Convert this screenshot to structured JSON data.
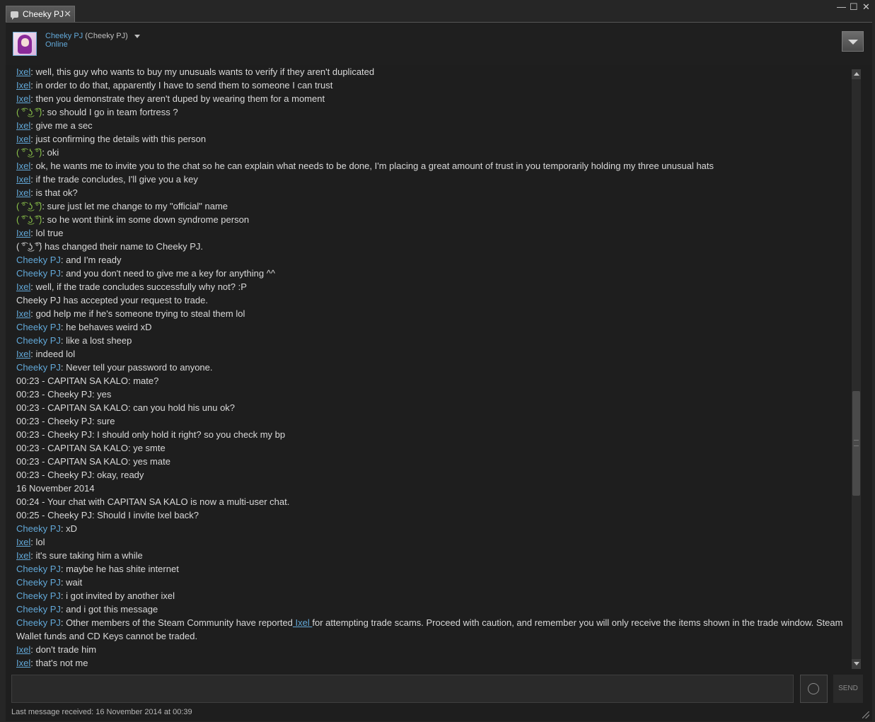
{
  "tab": {
    "title": "Cheeky PJ",
    "close": "✕"
  },
  "window": {
    "minimize": "—",
    "maximize": "☐",
    "close": "✕"
  },
  "friend": {
    "name": "Cheeky PJ",
    "alias": "(Cheeky PJ)",
    "status": "Online"
  },
  "messages": [
    {
      "sender": "Ixel",
      "style": "ixel",
      "sep": ": ",
      "text": "well, this guy who wants to buy my unusuals wants to verify if they aren't duplicated"
    },
    {
      "sender": "Ixel",
      "style": "ixel",
      "sep": ": ",
      "text": "in order to do that, apparently I have to send them to someone I can trust"
    },
    {
      "sender": "Ixel",
      "style": "ixel",
      "sep": ": ",
      "text": "then you demonstrate they aren't duped by wearing them for a moment"
    },
    {
      "sender": "( ͡° ͜ʖ ͡°)",
      "style": "lenny",
      "sep": ": ",
      "text": "so should I go in team fortress ?"
    },
    {
      "sender": "Ixel",
      "style": "ixel",
      "sep": ": ",
      "text": "give me a sec"
    },
    {
      "sender": "Ixel",
      "style": "ixel",
      "sep": ": ",
      "text": "just confirming the details with this person"
    },
    {
      "sender": "( ͡° ͜ʖ ͡°)",
      "style": "lenny",
      "sep": ": ",
      "text": "oki"
    },
    {
      "sender": "Ixel",
      "style": "ixel",
      "sep": ": ",
      "text": "ok, he wants me to invite you to the chat so he can explain what needs to be done, I'm placing a great amount of trust in you temporarily holding my three unusual hats"
    },
    {
      "sender": "Ixel",
      "style": "ixel",
      "sep": ": ",
      "text": "if the trade concludes, I'll give you a key"
    },
    {
      "sender": "Ixel",
      "style": "ixel",
      "sep": ": ",
      "text": "is that ok?"
    },
    {
      "sender": "( ͡° ͜ʖ ͡°)",
      "style": "lenny",
      "sep": ": ",
      "text": "sure just let me change to my \"official\" name"
    },
    {
      "sender": "( ͡° ͜ʖ ͡°)",
      "style": "lenny",
      "sep": ": ",
      "text": "so he wont think im some down syndrome person"
    },
    {
      "sender": "Ixel",
      "style": "ixel",
      "sep": ": ",
      "text": "lol true"
    },
    {
      "sender": "",
      "style": "plain",
      "sep": "",
      "text": "( ͡° ͜ʖ ͡°) has changed their name to Cheeky PJ."
    },
    {
      "sender": "Cheeky PJ",
      "style": "cheeky",
      "sep": ": ",
      "text": "and I'm ready"
    },
    {
      "sender": "Cheeky PJ",
      "style": "cheeky",
      "sep": ": ",
      "text": "and you don't need to give me a key for anything ^^"
    },
    {
      "sender": "Ixel",
      "style": "ixel",
      "sep": ": ",
      "text": "well, if the trade concludes successfully why not? :P"
    },
    {
      "sender": "",
      "style": "plain",
      "sep": "",
      "text": "Cheeky PJ has accepted your request to trade."
    },
    {
      "sender": "Ixel",
      "style": "ixel",
      "sep": ": ",
      "text": "god help me if he's someone trying to steal them lol"
    },
    {
      "sender": "Cheeky PJ",
      "style": "cheeky",
      "sep": ": ",
      "text": "he behaves weird xD"
    },
    {
      "sender": "Cheeky PJ",
      "style": "cheeky",
      "sep": ": ",
      "text": "like a lost sheep"
    },
    {
      "sender": "Ixel",
      "style": "ixel",
      "sep": ": ",
      "text": "indeed lol"
    },
    {
      "sender": "Cheeky PJ",
      "style": "cheeky",
      "sep": ": ",
      "text": "Never tell your password to anyone."
    },
    {
      "sender": "",
      "style": "plain",
      "sep": "",
      "text": "00:23 - CAPITAN SA KALO: mate?"
    },
    {
      "sender": "",
      "style": "plain",
      "sep": "",
      "text": "00:23 - Cheeky PJ: yes"
    },
    {
      "sender": "",
      "style": "plain",
      "sep": "",
      "text": "00:23 - CAPITAN SA KALO: can you hold his unu ok?"
    },
    {
      "sender": "",
      "style": "plain",
      "sep": "",
      "text": "00:23 - Cheeky PJ: sure"
    },
    {
      "sender": "",
      "style": "plain",
      "sep": "",
      "text": "00:23 - Cheeky PJ: I should only hold it right? so you check my bp"
    },
    {
      "sender": "",
      "style": "plain",
      "sep": "",
      "text": "00:23 - CAPITAN SA KALO: ye smte"
    },
    {
      "sender": "",
      "style": "plain",
      "sep": "",
      "text": "00:23 - CAPITAN SA KALO: yes mate"
    },
    {
      "sender": "",
      "style": "plain",
      "sep": "",
      "text": "00:23 - Cheeky PJ: okay, ready"
    },
    {
      "sender": "",
      "style": "plain",
      "sep": "",
      "text": "16 November 2014"
    },
    {
      "sender": "",
      "style": "plain",
      "sep": "",
      "text": "00:24 - Your chat with CAPITAN SA KALO is now a multi-user chat."
    },
    {
      "sender": "",
      "style": "plain",
      "sep": "",
      "text": "00:25 - Cheeky PJ: Should I invite Ixel back?"
    },
    {
      "sender": "Cheeky PJ",
      "style": "cheeky",
      "sep": ": ",
      "text": "xD"
    },
    {
      "sender": "Ixel",
      "style": "ixel",
      "sep": ": ",
      "text": "lol"
    },
    {
      "sender": "Ixel",
      "style": "ixel",
      "sep": ": ",
      "text": "it's sure taking him a while"
    },
    {
      "sender": "Cheeky PJ",
      "style": "cheeky",
      "sep": ": ",
      "text": "maybe he has shite internet"
    },
    {
      "sender": "Cheeky PJ",
      "style": "cheeky",
      "sep": ": ",
      "text": "wait"
    },
    {
      "sender": "Cheeky PJ",
      "style": "cheeky",
      "sep": ": ",
      "text": "i got invited by another ixel"
    },
    {
      "sender": "Cheeky PJ",
      "style": "cheeky",
      "sep": ": ",
      "text": "and i got this message"
    },
    {
      "sender": "Cheeky PJ",
      "style": "cheeky",
      "sep": ": ",
      "text": "Other members of the Steam Community have reported",
      "mention": " Ixel ",
      "text2": "for attempting trade scams. Proceed with caution, and remember you will only receive the items shown in the trade window. Steam Wallet funds and CD Keys cannot be traded."
    },
    {
      "sender": "Ixel",
      "style": "ixel",
      "sep": ": ",
      "text": "don't trade him"
    },
    {
      "sender": "Ixel",
      "style": "ixel",
      "sep": ": ",
      "text": "that's not me"
    }
  ],
  "input": {
    "placeholder": ""
  },
  "buttons": {
    "send": "SEND"
  },
  "footer": {
    "status": "Last message received: 16 November 2014 at 00:39"
  }
}
